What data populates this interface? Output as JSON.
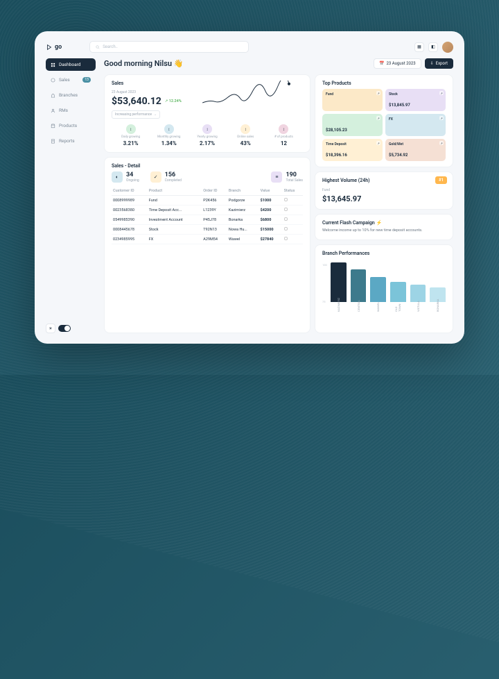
{
  "brand": "go",
  "search": {
    "placeholder": "Search.."
  },
  "greeting": "Good morning Nilsu 👋",
  "date_btn": "23 August 2023",
  "export_btn": "Export",
  "nav": {
    "dashboard": "Dashboard",
    "sales": "Sales",
    "sales_badge": "13",
    "branches": "Branches",
    "rms": "RMs",
    "products": "Products",
    "reports": "Reports"
  },
  "sales": {
    "title": "Sales",
    "date": "23 August 2023",
    "total": "$53,640.12",
    "pct": "12.24%",
    "perf": "Increasing performance",
    "metrics": [
      {
        "label": "Daily growing",
        "value": "3.21%"
      },
      {
        "label": "Monthly growing",
        "value": "1.34%"
      },
      {
        "label": "Yearly growing",
        "value": "2.17%"
      },
      {
        "label": "Online sales",
        "value": "43%"
      },
      {
        "label": "# of products",
        "value": "12"
      }
    ]
  },
  "detail": {
    "title": "Sales - Detail",
    "ongoing": {
      "n": "34",
      "l": "Ongoing"
    },
    "completed": {
      "n": "156",
      "l": "Completed"
    },
    "total": {
      "n": "190",
      "l": "Total Sales"
    },
    "cols": [
      "Customer ID",
      "Product",
      "Order ID",
      "Branch",
      "Value",
      "Status"
    ],
    "rows": [
      [
        "0008999989",
        "Fund",
        "P2K456",
        "Podgorze",
        "$1000"
      ],
      [
        "0023568380",
        "Time Deposit Acc...",
        "L1239Y",
        "Kazimierz",
        "$4200"
      ],
      [
        "0549985390",
        "Investment Account",
        "P45J78",
        "Bonarka",
        "$6800"
      ],
      [
        "0008445678",
        "Stock",
        "T92N13",
        "Nowa Hu...",
        "$15000"
      ],
      [
        "0234985995",
        "FX",
        "A29M54",
        "Wawel",
        "$27840"
      ]
    ]
  },
  "top": {
    "title": "Top Products",
    "items": [
      {
        "name": "Fund",
        "val": ""
      },
      {
        "name": "Stock",
        "val": "$13,845.97"
      },
      {
        "name": "",
        "val": "$28,105.23"
      },
      {
        "name": "FX",
        "val": ""
      },
      {
        "name": "Time Deposit",
        "val": "$18,396.16"
      },
      {
        "name": "Gold/Met",
        "val": "$5,734.92"
      }
    ]
  },
  "volume": {
    "title": "Highest Volume (24h)",
    "label": "Fund",
    "value": "$13,645.97",
    "rank": "#1"
  },
  "campaign": {
    "title": "Current Flash Campaign ⚡",
    "text": "Welcome income up to 10% for new time deposit accounts."
  },
  "branch": {
    "title": "Branch Performances",
    "yticks": [
      "100",
      "75"
    ],
    "chart_data": {
      "type": "bar",
      "categories": [
        "KAZIMIERZ",
        "CENTRAL",
        "WAWEL",
        "OLD TOWN",
        "VISTULA",
        "BONARKA"
      ],
      "values": [
        98,
        80,
        62,
        50,
        42,
        35
      ],
      "ylim": [
        0,
        100
      ]
    }
  }
}
